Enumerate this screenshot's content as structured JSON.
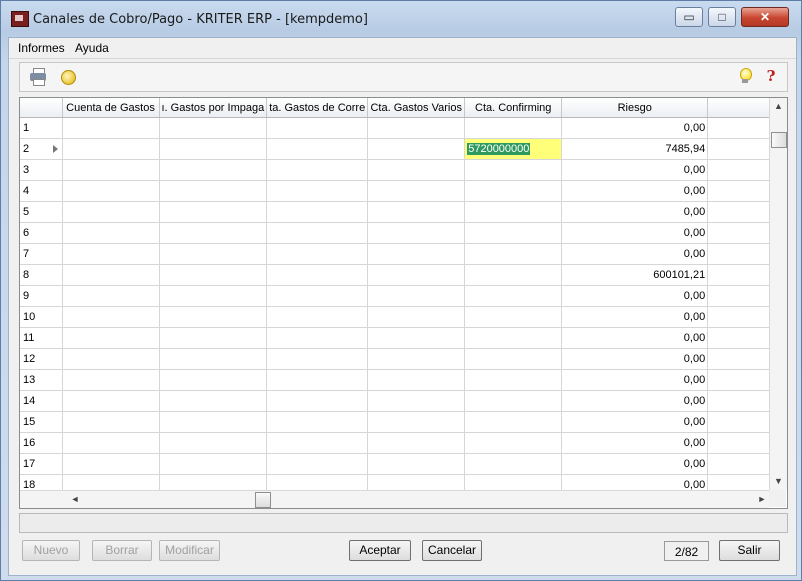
{
  "window": {
    "title": "Canales de Cobro/Pago - KRITER ERP - [kempdemo]",
    "min_glyph": "▭",
    "max_glyph": "□",
    "close_glyph": "✕"
  },
  "menu": [
    "Informes",
    "Ayuda"
  ],
  "toolbar": {
    "left_icons": [
      "printer-icon",
      "wizard-icon"
    ],
    "right_icons": [
      "lightbulb-icon",
      "help-icon"
    ],
    "help_glyph": "?"
  },
  "grid": {
    "columns": [
      "",
      "Cuenta de Gastos",
      "ı. Gastos por Impaga",
      "ta. Gastos de Corre",
      "Cta. Gastos Varios",
      "Cta. Confirming",
      "Riesgo",
      ""
    ],
    "rows": [
      {
        "n": "1",
        "confirming": "",
        "riesgo": "0,00"
      },
      {
        "n": "2",
        "confirming": "5720000000",
        "riesgo": "7485,94"
      },
      {
        "n": "3",
        "confirming": "",
        "riesgo": "0,00"
      },
      {
        "n": "4",
        "confirming": "",
        "riesgo": "0,00"
      },
      {
        "n": "5",
        "confirming": "",
        "riesgo": "0,00"
      },
      {
        "n": "6",
        "confirming": "",
        "riesgo": "0,00"
      },
      {
        "n": "7",
        "confirming": "",
        "riesgo": "0,00"
      },
      {
        "n": "8",
        "confirming": "",
        "riesgo": "600101,21"
      },
      {
        "n": "9",
        "confirming": "",
        "riesgo": "0,00"
      },
      {
        "n": "10",
        "confirming": "",
        "riesgo": "0,00"
      },
      {
        "n": "11",
        "confirming": "",
        "riesgo": "0,00"
      },
      {
        "n": "12",
        "confirming": "",
        "riesgo": "0,00"
      },
      {
        "n": "13",
        "confirming": "",
        "riesgo": "0,00"
      },
      {
        "n": "14",
        "confirming": "",
        "riesgo": "0,00"
      },
      {
        "n": "15",
        "confirming": "",
        "riesgo": "0,00"
      },
      {
        "n": "16",
        "confirming": "",
        "riesgo": "0,00"
      },
      {
        "n": "17",
        "confirming": "",
        "riesgo": "0,00"
      },
      {
        "n": "18",
        "confirming": "",
        "riesgo": "0,00"
      }
    ],
    "current_row": "2",
    "scroll_up": "▲",
    "scroll_down": "▼",
    "scroll_left": "◄",
    "scroll_right": "►"
  },
  "buttons": {
    "nuevo": "Nuevo",
    "borrar": "Borrar",
    "modificar": "Modificar",
    "aceptar": "Aceptar",
    "cancelar": "Cancelar",
    "salir": "Salir"
  },
  "pager": "2/82",
  "colors": {
    "selected_cell_bg": "#ffff7a",
    "selected_text_bg": "#2f9a5e"
  }
}
